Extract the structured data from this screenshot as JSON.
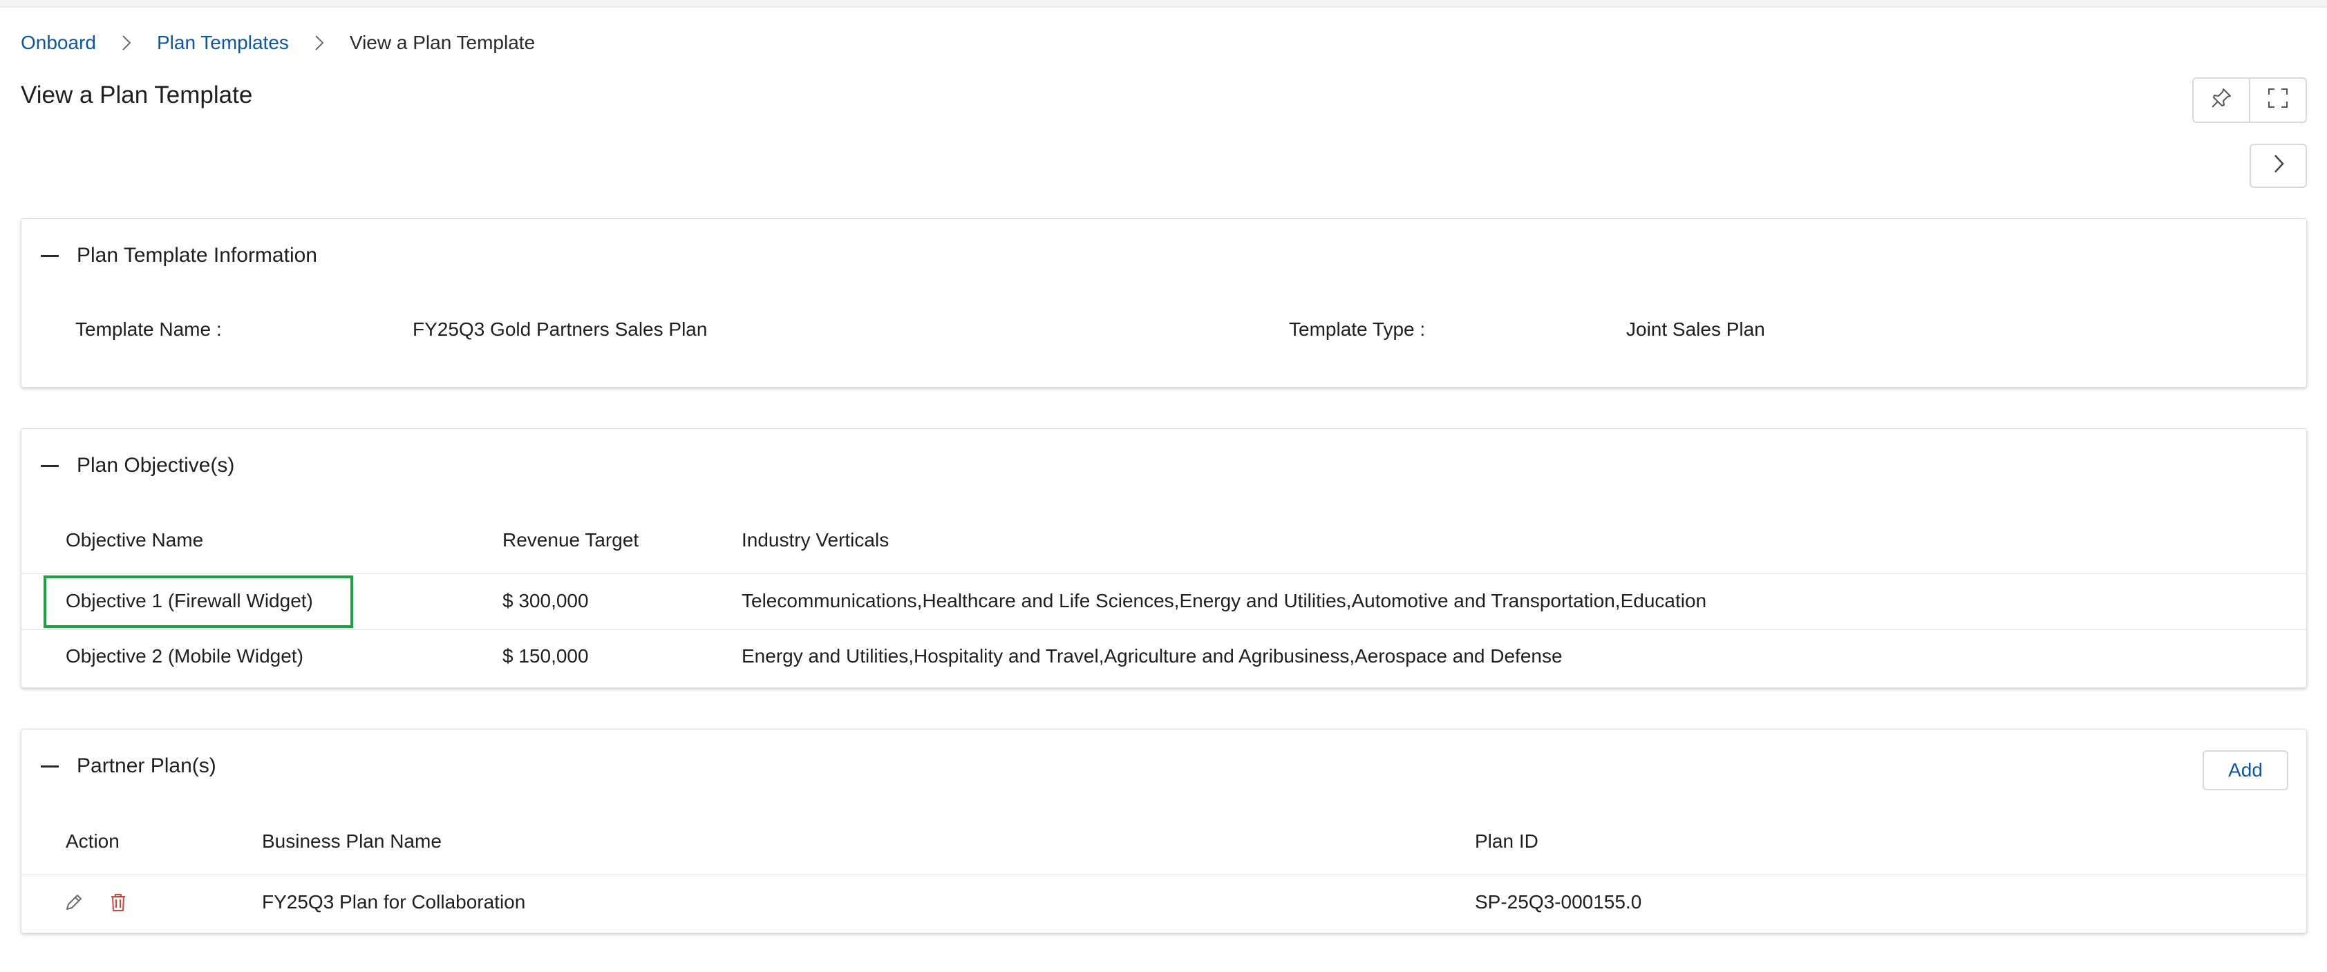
{
  "breadcrumb": {
    "items": [
      "Onboard",
      "Plan Templates"
    ],
    "current": "View a Plan Template"
  },
  "page_title": "View a Plan Template",
  "toolbar": {
    "pin_icon": "pin-icon",
    "expand_icon": "fullscreen-icon",
    "next_icon": "chevron-right-icon"
  },
  "plan_template_info": {
    "title": "Plan Template Information",
    "template_name_label": "Template Name :",
    "template_name_value": "FY25Q3 Gold Partners Sales Plan",
    "template_type_label": "Template Type :",
    "template_type_value": "Joint Sales Plan"
  },
  "plan_objectives": {
    "title": "Plan Objective(s)",
    "columns": [
      "Objective Name",
      "Revenue Target",
      "Industry Verticals"
    ],
    "rows": [
      {
        "name": "Objective 1 (Firewall Widget)",
        "revenue": "$ 300,000",
        "verticals": "Telecommunications,Healthcare and Life Sciences,Energy and Utilities,Automotive and Transportation,Education"
      },
      {
        "name": "Objective 2 (Mobile Widget)",
        "revenue": "$ 150,000",
        "verticals": "Energy and Utilities,Hospitality and Travel,Agriculture and Agribusiness,Aerospace and Defense"
      }
    ]
  },
  "partner_plans": {
    "title": "Partner Plan(s)",
    "add_label": "Add",
    "columns": [
      "Action",
      "Business Plan Name",
      "Plan ID"
    ],
    "rows": [
      {
        "name": "FY25Q3 Plan for Collaboration",
        "plan_id": "SP-25Q3-000155.0"
      }
    ]
  },
  "colors": {
    "link": "#0b57a4",
    "highlight": "#1aa33f",
    "delete": "#d0453a"
  }
}
